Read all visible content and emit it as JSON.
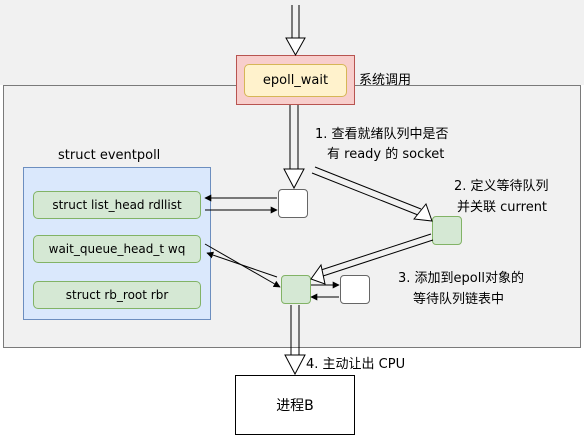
{
  "syscall": {
    "function": "epoll_wait",
    "type_label": "系统调用"
  },
  "eventpoll": {
    "title": "struct eventpoll",
    "fields": [
      "struct list_head rdllist",
      "wait_queue_head_t wq",
      "struct rb_root rbr"
    ]
  },
  "steps": {
    "step1_line1": "1. 查看就绪队列中是否",
    "step1_line2": "有 ready 的 socket",
    "step2_line1": "2. 定义等待队列",
    "step2_line2": "并关联 current",
    "step3_line1": "3. 添加到epoll对象的",
    "step3_line2": "等待队列链表中",
    "step4": "4. 主动让出 CPU"
  },
  "process": {
    "label": "进程B"
  },
  "colors": {
    "panel_bg": "#f1f1f1",
    "syscall_outer": "#f8cecc",
    "syscall_inner": "#fff2cc",
    "eventpoll_bg": "#dae8fc",
    "node_green": "#d5e8d4"
  }
}
